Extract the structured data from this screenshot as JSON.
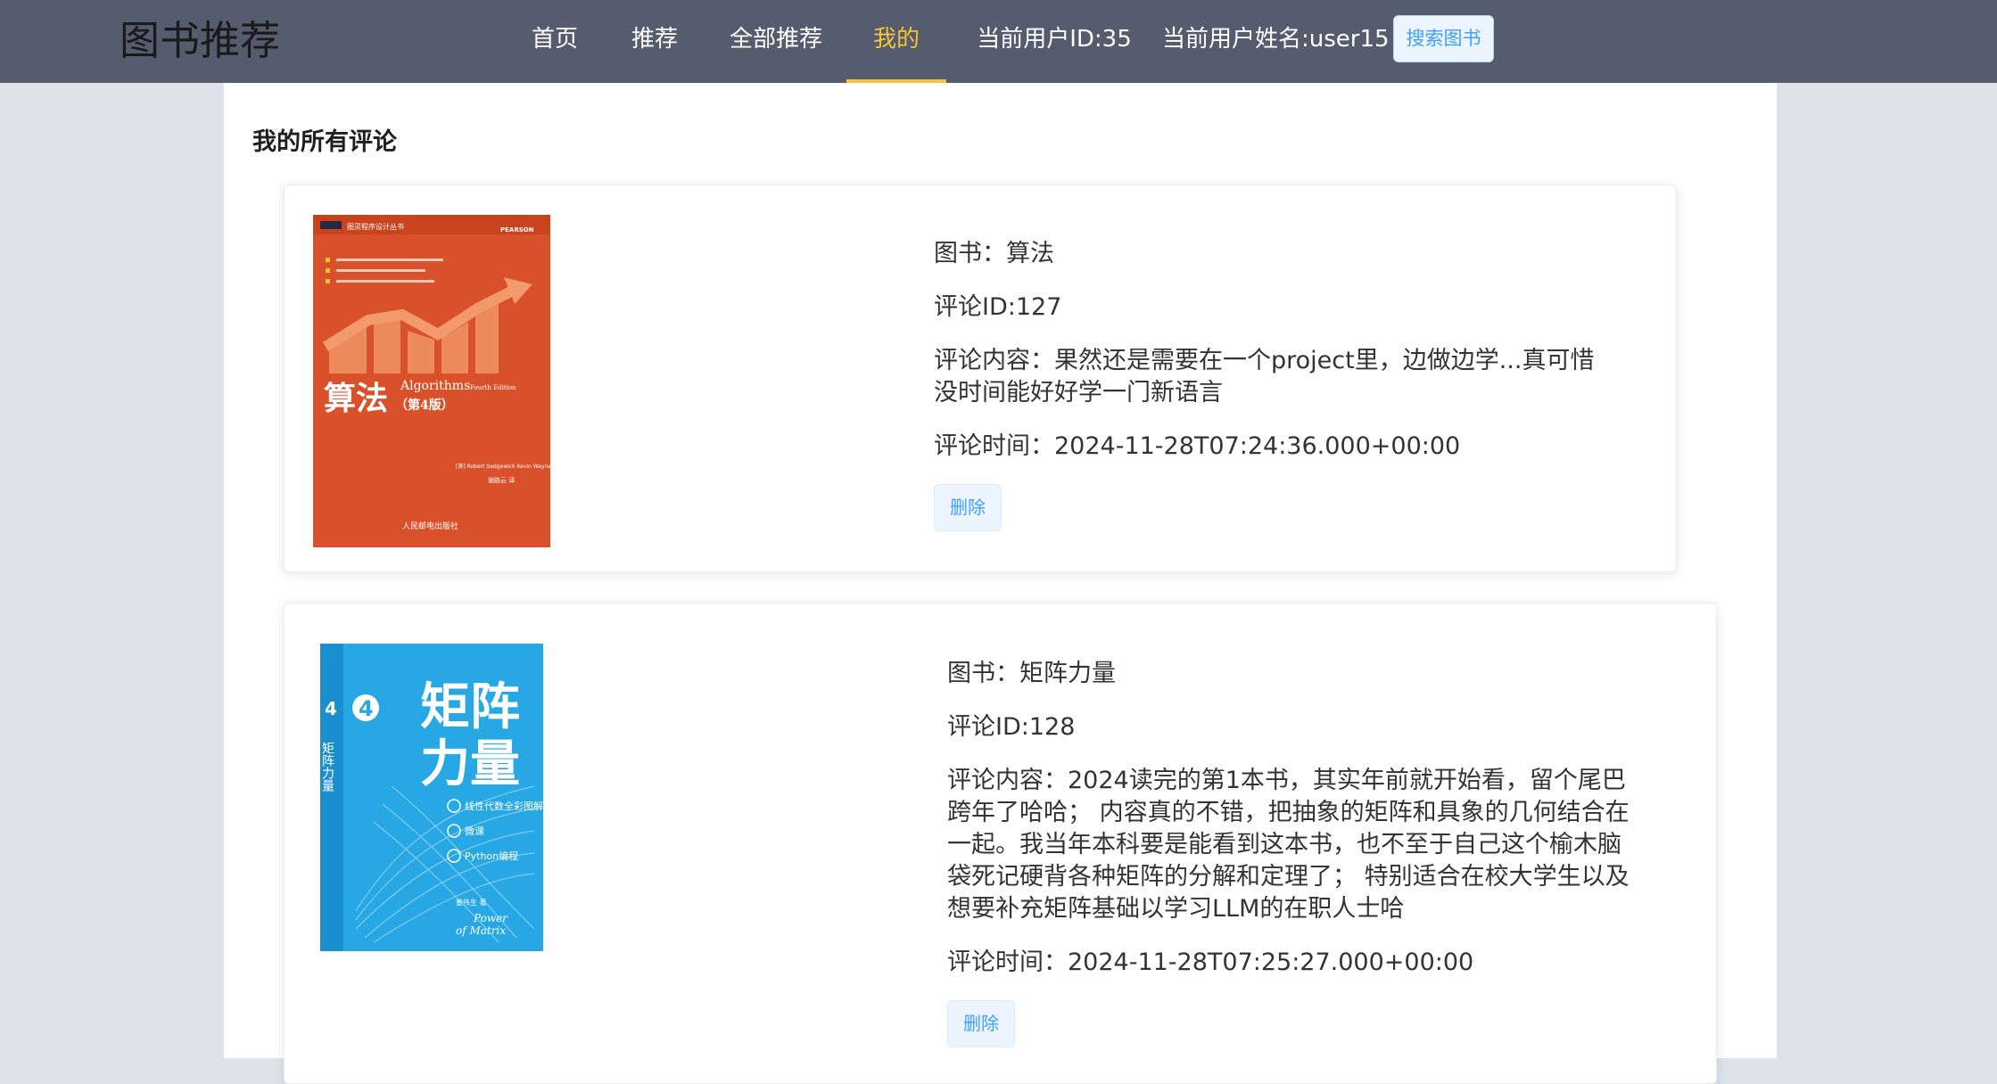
{
  "header": {
    "brand": "图书推荐",
    "nav": {
      "home": "首页",
      "recommend": "推荐",
      "all_recommend": "全部推荐",
      "mine": "我的",
      "user_id": "当前用户ID:35",
      "user_name": "当前用户姓名:user15"
    },
    "search_label": "搜索图书",
    "active_color": "#f5c23a"
  },
  "main": {
    "title": "我的所有评论",
    "reviews": [
      {
        "book": "图书：算法",
        "review_id": "评论ID:127",
        "content": "评论内容：果然还是需要在一个project里，边做边学...真可惜没时间能好好学一门新语言",
        "time": "评论时间：2024-11-28T07:24:36.000+00:00",
        "delete_label": "删除",
        "cover": {
          "title": "算法",
          "subtitle": "Algorithms",
          "edition_en": "Fourth Edition",
          "edition": "（第4版）",
          "series": "图灵程序设计丛书",
          "publisher_logo": "PEARSON",
          "authors": "[美] Robert Sedgewick Kevin Wayne 著",
          "translator": "谢路云 译",
          "publisher": "人民邮电出版社",
          "color": "#d9512a"
        }
      },
      {
        "book": "图书：矩阵力量",
        "review_id": "评论ID:128",
        "content": "评论内容：2024读完的第1本书，其实年前就开始看，留个尾巴跨年了哈哈； 内容真的不错，把抽象的矩阵和具象的几何结合在一起。我当年本科要是能看到这本书，也不至于自己这个榆木脑袋死记硬背各种矩阵的分解和定理了； 特别适合在校大学生以及想要补充矩阵基础以学习LLM的在职人士哈",
        "time": "评论时间：2024-11-28T07:25:27.000+00:00",
        "delete_label": "删除",
        "cover": {
          "number": "4",
          "title_line1": "矩阵",
          "title_line2": "力量",
          "spine": "矩阵力量",
          "features": [
            "线性代数全彩图解",
            "微课",
            "Python编程"
          ],
          "en_line1": "Power",
          "en_line2": "of Matrix",
          "author": "姜伟生 著",
          "color": "#27a7e4"
        }
      }
    ]
  }
}
